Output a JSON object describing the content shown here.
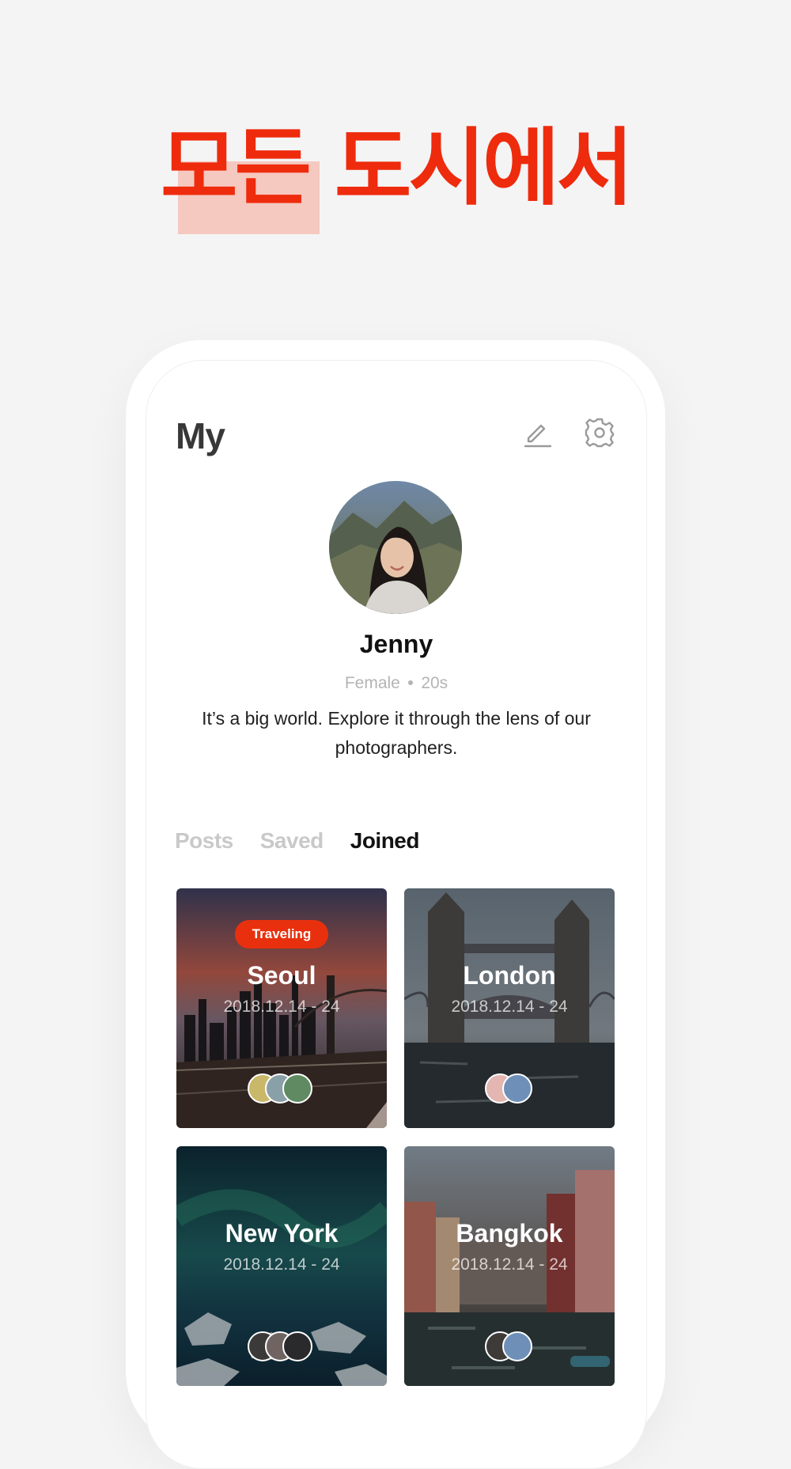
{
  "headline": {
    "highlight": "모든",
    "rest": "도시에서"
  },
  "header": {
    "title": "My"
  },
  "profile": {
    "name": "Jenny",
    "gender": "Female",
    "age": "20s",
    "bio": "It’s a big world. Explore it through the lens of our photographers."
  },
  "tabs": [
    {
      "label": "Posts",
      "active": false
    },
    {
      "label": "Saved",
      "active": false
    },
    {
      "label": "Joined",
      "active": true
    }
  ],
  "trips": [
    {
      "city": "Seoul",
      "dates": "2018.12.14 - 24",
      "badge": "Traveling",
      "members": 3
    },
    {
      "city": "London",
      "dates": "2018.12.14 - 24",
      "badge": "",
      "members": 2
    },
    {
      "city": "New York",
      "dates": "2018.12.14 - 24",
      "badge": "",
      "members": 3
    },
    {
      "city": "Bangkok",
      "dates": "2018.12.14 - 24",
      "badge": "",
      "members": 2
    }
  ],
  "icons": {
    "edit": "pencil-icon",
    "settings": "gear-icon"
  },
  "colors": {
    "accent": "#ee2b0d",
    "highlight": "#f5c8c0",
    "badge": "#e8300e"
  }
}
